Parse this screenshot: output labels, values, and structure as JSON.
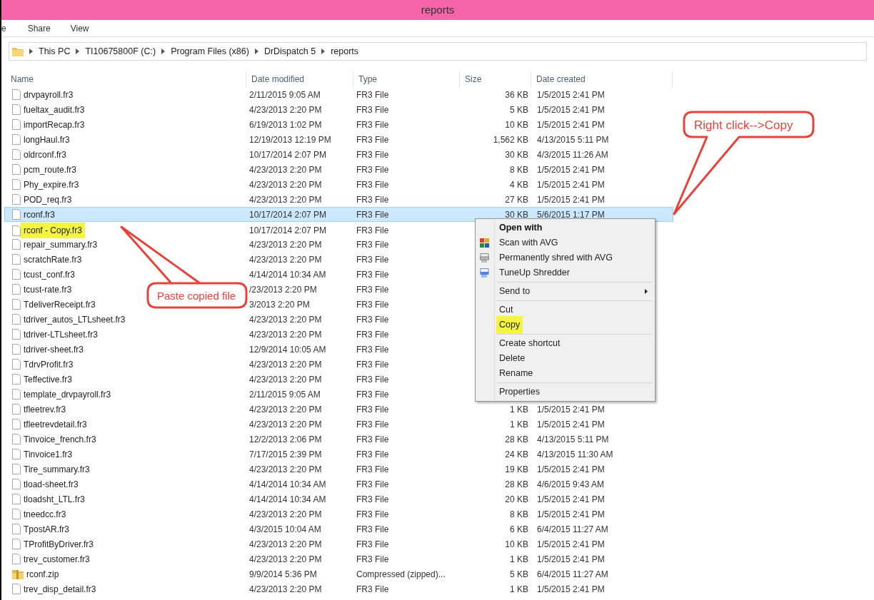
{
  "window": {
    "title": "reports"
  },
  "ribbon_tabs": [
    "e",
    "Share",
    "View"
  ],
  "breadcrumb": [
    "This PC",
    "TI10675800F (C:)",
    "Program Files (x86)",
    "DrDispatch 5",
    "reports"
  ],
  "columns": [
    "Name",
    "Date modified",
    "Type",
    "Size",
    "Date created"
  ],
  "rows": [
    {
      "kind": "file",
      "name": "drvpayroll.fr3",
      "modified": "2/11/2015 9:05 AM",
      "type": "FR3 File",
      "size": "36 KB",
      "created": "1/5/2015 2:41 PM",
      "selected": false,
      "highlighted": false
    },
    {
      "kind": "file",
      "name": "fueltax_audit.fr3",
      "modified": "4/23/2013 2:20 PM",
      "type": "FR3 File",
      "size": "5 KB",
      "created": "1/5/2015 2:41 PM",
      "selected": false,
      "highlighted": false
    },
    {
      "kind": "file",
      "name": "importRecap.fr3",
      "modified": "6/19/2013 1:02 PM",
      "type": "FR3 File",
      "size": "10 KB",
      "created": "1/5/2015 2:41 PM",
      "selected": false,
      "highlighted": false
    },
    {
      "kind": "file",
      "name": "longHaul.fr3",
      "modified": "12/19/2013 12:19 PM",
      "type": "FR3 File",
      "size": "1,562 KB",
      "created": "4/13/2015 5:11 PM",
      "selected": false,
      "highlighted": false
    },
    {
      "kind": "file",
      "name": "oldrconf.fr3",
      "modified": "10/17/2014 2:07 PM",
      "type": "FR3 File",
      "size": "30 KB",
      "created": "4/3/2015 11:26 AM",
      "selected": false,
      "highlighted": false
    },
    {
      "kind": "file",
      "name": "pcm_route.fr3",
      "modified": "4/23/2013 2:20 PM",
      "type": "FR3 File",
      "size": "8 KB",
      "created": "1/5/2015 2:41 PM",
      "selected": false,
      "highlighted": false
    },
    {
      "kind": "file",
      "name": "Phy_expire.fr3",
      "modified": "4/23/2013 2:20 PM",
      "type": "FR3 File",
      "size": "4 KB",
      "created": "1/5/2015 2:41 PM",
      "selected": false,
      "highlighted": false
    },
    {
      "kind": "file",
      "name": "POD_req.fr3",
      "modified": "4/23/2013 2:20 PM",
      "type": "FR3 File",
      "size": "27 KB",
      "created": "1/5/2015 2:41 PM",
      "selected": false,
      "highlighted": false
    },
    {
      "kind": "file",
      "name": "rconf.fr3",
      "modified": "10/17/2014 2:07 PM",
      "type": "FR3 File",
      "size": "30 KB",
      "created": "5/6/2015 1:17 PM",
      "selected": true,
      "highlighted": false
    },
    {
      "kind": "file",
      "name": "rconf - Copy.fr3",
      "modified": "10/17/2014 2:07 PM",
      "type": "FR3 File",
      "selected": false,
      "highlighted": true
    },
    {
      "kind": "file",
      "name": "repair_summary.fr3",
      "modified": "4/23/2013 2:20 PM",
      "type": "FR3 File",
      "selected": false,
      "highlighted": false
    },
    {
      "kind": "file",
      "name": "scratchRate.fr3",
      "modified": "4/23/2013 2:20 PM",
      "type": "FR3 File",
      "selected": false,
      "highlighted": false
    },
    {
      "kind": "file",
      "name": "tcust_conf.fr3",
      "modified": "4/14/2014 10:34 AM",
      "type": "FR3 File",
      "selected": false,
      "highlighted": false
    },
    {
      "kind": "file",
      "name": "tcust-rate.fr3",
      "modified": "/23/2013 2:20 PM",
      "type": "FR3 File",
      "selected": false,
      "highlighted": false
    },
    {
      "kind": "file",
      "name": "TdeliverReceipt.fr3",
      "modified": "3/2013 2:20 PM",
      "type": "FR3 File",
      "selected": false,
      "highlighted": false
    },
    {
      "kind": "file",
      "name": "tdriver_autos_LTLsheet.fr3",
      "modified": "4/23/2013 2:20 PM",
      "type": "FR3 File",
      "selected": false,
      "highlighted": false
    },
    {
      "kind": "file",
      "name": "tdriver-LTLsheet.fr3",
      "modified": "4/23/2013 2:20 PM",
      "type": "FR3 File",
      "selected": false,
      "highlighted": false
    },
    {
      "kind": "file",
      "name": "tdriver-sheet.fr3",
      "modified": "12/9/2014 10:05 AM",
      "type": "FR3 File",
      "selected": false,
      "highlighted": false
    },
    {
      "kind": "file",
      "name": "TdrvProfit.fr3",
      "modified": "4/23/2013 2:20 PM",
      "type": "FR3 File",
      "selected": false,
      "highlighted": false
    },
    {
      "kind": "file",
      "name": "Teffective.fr3",
      "modified": "4/23/2013 2:20 PM",
      "type": "FR3 File",
      "selected": false,
      "highlighted": false
    },
    {
      "kind": "file",
      "name": "template_drvpayroll.fr3",
      "modified": "2/11/2015 9:05 AM",
      "type": "FR3 File",
      "selected": false,
      "highlighted": false
    },
    {
      "kind": "file",
      "name": "tfleetrev.fr3",
      "modified": "4/23/2013 2:20 PM",
      "type": "FR3 File",
      "size": "1 KB",
      "created": "1/5/2015 2:41 PM",
      "selected": false,
      "highlighted": false
    },
    {
      "kind": "file",
      "name": "tfleetrevdetail.fr3",
      "modified": "4/23/2013 2:20 PM",
      "type": "FR3 File",
      "size": "1 KB",
      "created": "1/5/2015 2:41 PM",
      "selected": false,
      "highlighted": false
    },
    {
      "kind": "file",
      "name": "Tinvoice_french.fr3",
      "modified": "12/2/2013 2:06 PM",
      "type": "FR3 File",
      "size": "28 KB",
      "created": "4/13/2015 5:11 PM",
      "selected": false,
      "highlighted": false
    },
    {
      "kind": "file",
      "name": "Tinvoice1.fr3",
      "modified": "7/17/2015 2:39 PM",
      "type": "FR3 File",
      "size": "24 KB",
      "created": "4/13/2015 11:30 AM",
      "selected": false,
      "highlighted": false
    },
    {
      "kind": "file",
      "name": "Tire_summary.fr3",
      "modified": "4/23/2013 2:20 PM",
      "type": "FR3 File",
      "size": "19 KB",
      "created": "1/5/2015 2:41 PM",
      "selected": false,
      "highlighted": false
    },
    {
      "kind": "file",
      "name": "tload-sheet.fr3",
      "modified": "4/14/2014 10:34 AM",
      "type": "FR3 File",
      "size": "28 KB",
      "created": "4/6/2015 9:43 AM",
      "selected": false,
      "highlighted": false
    },
    {
      "kind": "file",
      "name": "tloadsht_LTL.fr3",
      "modified": "4/14/2014 10:34 AM",
      "type": "FR3 File",
      "size": "20 KB",
      "created": "1/5/2015 2:41 PM",
      "selected": false,
      "highlighted": false
    },
    {
      "kind": "file",
      "name": "tneedcc.fr3",
      "modified": "4/23/2013 2:20 PM",
      "type": "FR3 File",
      "size": "8 KB",
      "created": "1/5/2015 2:41 PM",
      "selected": false,
      "highlighted": false
    },
    {
      "kind": "file",
      "name": "TpostAR.fr3",
      "modified": "4/3/2015 10:04 AM",
      "type": "FR3 File",
      "size": "6 KB",
      "created": "6/4/2015 11:27 AM",
      "selected": false,
      "highlighted": false
    },
    {
      "kind": "file",
      "name": "TProfitByDriver.fr3",
      "modified": "4/23/2013 2:20 PM",
      "type": "FR3 File",
      "size": "10 KB",
      "created": "1/5/2015 2:41 PM",
      "selected": false,
      "highlighted": false
    },
    {
      "kind": "file",
      "name": "trev_customer.fr3",
      "modified": "4/23/2013 2:20 PM",
      "type": "FR3 File",
      "size": "1 KB",
      "created": "1/5/2015 2:41 PM",
      "selected": false,
      "highlighted": false
    },
    {
      "kind": "zip",
      "name": "rconf.zip",
      "modified": "9/9/2014 5:36 PM",
      "type": "Compressed (zipped)...",
      "size": "5 KB",
      "created": "6/4/2015 11:27 AM",
      "selected": false,
      "highlighted": false
    },
    {
      "kind": "file",
      "name": "trev_disp_detail.fr3",
      "modified": "4/23/2013 2:20 PM",
      "type": "FR3 File",
      "size": "1 KB",
      "created": "1/5/2015 2:41 PM",
      "selected": false,
      "highlighted": false
    }
  ],
  "context_menu": [
    {
      "kind": "item",
      "label": "Open with",
      "default": true,
      "highlighted": false,
      "submenu": false
    },
    {
      "kind": "item",
      "label": "Scan with AVG",
      "default": false,
      "highlighted": false,
      "submenu": false
    },
    {
      "kind": "item",
      "label": "Permanently shred with AVG",
      "default": false,
      "highlighted": false,
      "submenu": false
    },
    {
      "kind": "item",
      "label": "TuneUp Shredder",
      "default": false,
      "highlighted": false,
      "submenu": false
    },
    {
      "kind": "separator"
    },
    {
      "kind": "item",
      "label": "Send to",
      "default": false,
      "highlighted": false,
      "submenu": true
    },
    {
      "kind": "separator"
    },
    {
      "kind": "item",
      "label": "Cut",
      "default": false,
      "highlighted": false,
      "submenu": false
    },
    {
      "kind": "item",
      "label": "Copy",
      "default": false,
      "highlighted": true,
      "submenu": false
    },
    {
      "kind": "separator"
    },
    {
      "kind": "item",
      "label": "Create shortcut",
      "default": false,
      "highlighted": false,
      "submenu": false
    },
    {
      "kind": "item",
      "label": "Delete",
      "default": false,
      "highlighted": false,
      "submenu": false
    },
    {
      "kind": "item",
      "label": "Rename",
      "default": false,
      "highlighted": false,
      "submenu": false
    },
    {
      "kind": "separator"
    },
    {
      "kind": "item",
      "label": "Properties",
      "default": false,
      "highlighted": false,
      "submenu": false
    }
  ],
  "callouts": [
    "Right click-->Copy",
    "Paste copied file"
  ]
}
